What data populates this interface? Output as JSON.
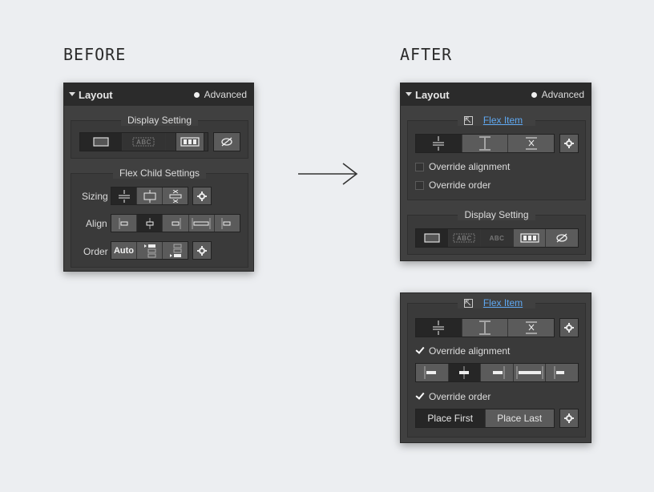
{
  "headings": {
    "before": "BEFORE",
    "after": "AFTER"
  },
  "panel": {
    "title": "Layout",
    "advanced": "Advanced"
  },
  "display": {
    "title": "Display Setting",
    "options": [
      "block-icon",
      "inline-block-icon",
      "inline-icon",
      "flex-icon",
      "hidden-icon"
    ],
    "inline_block_text": "ABC",
    "inline_text": "ABC"
  },
  "flex_child": {
    "title": "Flex Child Settings",
    "sizing_label": "Sizing",
    "align_label": "Align",
    "order_label": "Order",
    "order_auto": "Auto"
  },
  "flex_item": {
    "title": "Flex Item",
    "override_alignment": "Override alignment",
    "override_order": "Override order",
    "place_first": "Place First",
    "place_last": "Place Last",
    "override_alignment_checked": true,
    "override_order_checked": true
  },
  "colors": {
    "link": "#5ea8f2",
    "panel": "#404040",
    "header": "#2b2b2b"
  }
}
